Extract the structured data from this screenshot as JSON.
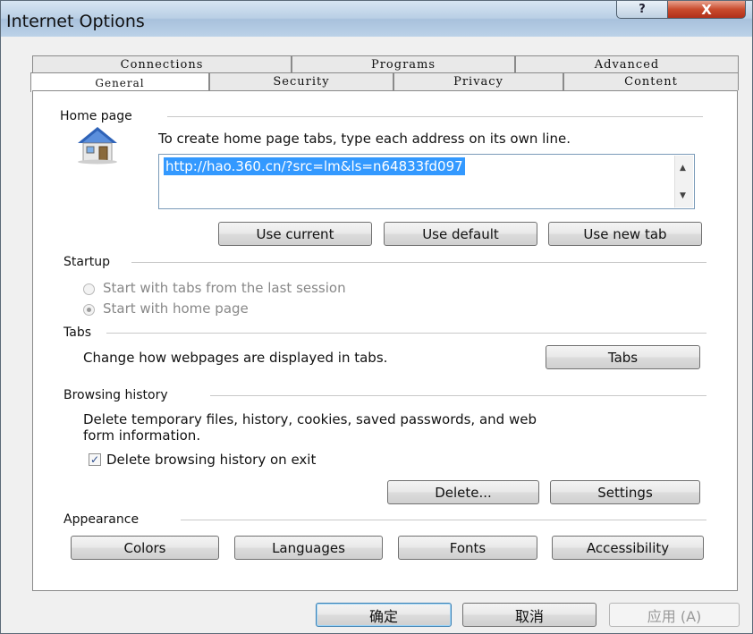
{
  "window": {
    "title": "Internet Options",
    "help_button": "?",
    "close_button": "X"
  },
  "tabs": {
    "back_row": [
      "Connections",
      "Programs",
      "Advanced"
    ],
    "front_row": [
      "General",
      "Security",
      "Privacy",
      "Content"
    ],
    "selected": "General"
  },
  "home_page": {
    "label": "Home page",
    "instruction": "To create home page tabs, type each address on its own line.",
    "url": "http://hao.360.cn/?src=lm&ls=n64833fd097",
    "buttons": [
      "Use current",
      "Use default",
      "Use new tab"
    ]
  },
  "startup": {
    "label": "Startup",
    "options": [
      "Start with tabs from the last session",
      "Start with home page"
    ],
    "selected_index": 1
  },
  "tabs_section": {
    "label": "Tabs",
    "description": "Change how webpages are displayed in tabs.",
    "button": "Tabs"
  },
  "browsing_history": {
    "label": "Browsing history",
    "description_line1": "Delete temporary files, history, cookies, saved passwords, and web",
    "description_line2": "form information.",
    "checkbox_label": "Delete browsing history on exit",
    "checked": true,
    "buttons": [
      "Delete...",
      "Settings"
    ]
  },
  "appearance": {
    "label": "Appearance",
    "buttons": [
      "Colors",
      "Languages",
      "Fonts",
      "Accessibility"
    ]
  },
  "footer": {
    "ok": "确定",
    "cancel": "取消",
    "apply": "应用 (A)"
  },
  "colors": {
    "selection": "#3399ff",
    "title_gradient_top": "#d7e5f2",
    "close_red": "#c94b2d"
  }
}
